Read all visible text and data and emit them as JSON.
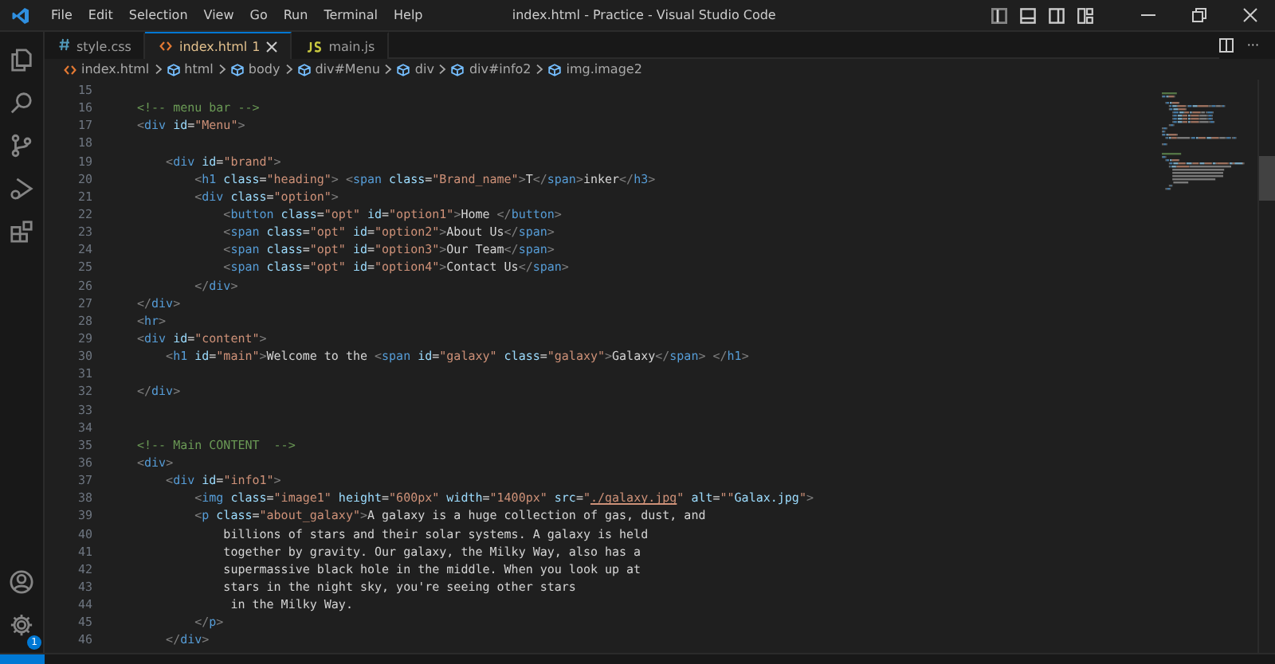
{
  "window": {
    "title": "index.html - Practice - Visual Studio Code"
  },
  "menu": [
    "File",
    "Edit",
    "Selection",
    "View",
    "Go",
    "Run",
    "Terminal",
    "Help"
  ],
  "tabs": [
    {
      "kind": "css",
      "label": "style.css",
      "selected": false
    },
    {
      "kind": "html",
      "label": "index.html",
      "problems": "1",
      "selected": true
    },
    {
      "kind": "js",
      "label": "main.js",
      "selected": false
    }
  ],
  "breadcrumbs": [
    {
      "kind": "file",
      "label": "index.html"
    },
    {
      "kind": "element",
      "label": "html"
    },
    {
      "kind": "element",
      "label": "body"
    },
    {
      "kind": "element",
      "label": "div#Menu"
    },
    {
      "kind": "element",
      "label": "div"
    },
    {
      "kind": "element",
      "label": "div#info2"
    },
    {
      "kind": "element",
      "label": "img.image2"
    }
  ],
  "editor_actions": {
    "more": "···"
  },
  "activity_bar": {
    "settings_badge": "1"
  },
  "editor": {
    "lines": [
      {
        "number": "15"
      },
      {
        "number": "16",
        "tokens": [
          {
            "kind": "comment",
            "text": "<!-- menu bar -->"
          }
        ]
      },
      {
        "number": "17",
        "tokens": [
          {
            "kind": "punct",
            "text": "<"
          },
          {
            "kind": "tag",
            "text": "div"
          },
          {
            "kind": "attr",
            "text": " id"
          },
          {
            "kind": "text",
            "text": "="
          },
          {
            "kind": "str",
            "text": "\"Menu\""
          },
          {
            "kind": "punct",
            "text": ">"
          }
        ]
      },
      {
        "number": "18"
      },
      {
        "number": "19",
        "tokens": [
          {
            "kind": "punct",
            "text": "    <"
          },
          {
            "kind": "tag",
            "text": "div"
          },
          {
            "kind": "attr",
            "text": " id"
          },
          {
            "kind": "text",
            "text": "="
          },
          {
            "kind": "str",
            "text": "\"brand\""
          },
          {
            "kind": "punct",
            "text": ">"
          }
        ]
      },
      {
        "number": "20",
        "tokens": [
          {
            "kind": "punct",
            "text": "        <"
          },
          {
            "kind": "tag",
            "text": "h1"
          },
          {
            "kind": "attr",
            "text": " class"
          },
          {
            "kind": "text",
            "text": "="
          },
          {
            "kind": "str",
            "text": "\"heading\""
          },
          {
            "kind": "punct",
            "text": ">"
          },
          {
            "kind": "punct",
            "text": " <"
          },
          {
            "kind": "tag",
            "text": "span"
          },
          {
            "kind": "attr",
            "text": " class"
          },
          {
            "kind": "text",
            "text": "="
          },
          {
            "kind": "str",
            "text": "\"Brand_name\""
          },
          {
            "kind": "punct",
            "text": ">"
          },
          {
            "kind": "text",
            "text": "T"
          },
          {
            "kind": "punct",
            "text": "</"
          },
          {
            "kind": "tag",
            "text": "span"
          },
          {
            "kind": "punct",
            "text": ">"
          },
          {
            "kind": "text",
            "text": "inker"
          },
          {
            "kind": "punct",
            "text": "</"
          },
          {
            "kind": "tag",
            "text": "h3"
          },
          {
            "kind": "punct",
            "text": ">"
          }
        ]
      },
      {
        "number": "21",
        "tokens": [
          {
            "kind": "punct",
            "text": "        <"
          },
          {
            "kind": "tag",
            "text": "div"
          },
          {
            "kind": "attr",
            "text": " class"
          },
          {
            "kind": "text",
            "text": "="
          },
          {
            "kind": "str",
            "text": "\"option\""
          },
          {
            "kind": "punct",
            "text": ">"
          }
        ]
      },
      {
        "number": "22",
        "tokens": [
          {
            "kind": "punct",
            "text": "            <"
          },
          {
            "kind": "tag",
            "text": "button"
          },
          {
            "kind": "attr",
            "text": " class"
          },
          {
            "kind": "text",
            "text": "="
          },
          {
            "kind": "str",
            "text": "\"opt\""
          },
          {
            "kind": "attr",
            "text": " id"
          },
          {
            "kind": "text",
            "text": "="
          },
          {
            "kind": "str",
            "text": "\"option1\""
          },
          {
            "kind": "punct",
            "text": ">"
          },
          {
            "kind": "text",
            "text": "Home "
          },
          {
            "kind": "punct",
            "text": "</"
          },
          {
            "kind": "tag",
            "text": "button"
          },
          {
            "kind": "punct",
            "text": ">"
          }
        ]
      },
      {
        "number": "23",
        "tokens": [
          {
            "kind": "punct",
            "text": "            <"
          },
          {
            "kind": "tag",
            "text": "span"
          },
          {
            "kind": "attr",
            "text": " class"
          },
          {
            "kind": "text",
            "text": "="
          },
          {
            "kind": "str",
            "text": "\"opt\""
          },
          {
            "kind": "attr",
            "text": " id"
          },
          {
            "kind": "text",
            "text": "="
          },
          {
            "kind": "str",
            "text": "\"option2\""
          },
          {
            "kind": "punct",
            "text": ">"
          },
          {
            "kind": "text",
            "text": "About Us"
          },
          {
            "kind": "punct",
            "text": "</"
          },
          {
            "kind": "tag",
            "text": "span"
          },
          {
            "kind": "punct",
            "text": ">"
          }
        ]
      },
      {
        "number": "24",
        "tokens": [
          {
            "kind": "punct",
            "text": "            <"
          },
          {
            "kind": "tag",
            "text": "span"
          },
          {
            "kind": "attr",
            "text": " class"
          },
          {
            "kind": "text",
            "text": "="
          },
          {
            "kind": "str",
            "text": "\"opt\""
          },
          {
            "kind": "attr",
            "text": " id"
          },
          {
            "kind": "text",
            "text": "="
          },
          {
            "kind": "str",
            "text": "\"option3\""
          },
          {
            "kind": "punct",
            "text": ">"
          },
          {
            "kind": "text",
            "text": "Our Team"
          },
          {
            "kind": "punct",
            "text": "</"
          },
          {
            "kind": "tag",
            "text": "span"
          },
          {
            "kind": "punct",
            "text": ">"
          }
        ]
      },
      {
        "number": "25",
        "tokens": [
          {
            "kind": "punct",
            "text": "            <"
          },
          {
            "kind": "tag",
            "text": "span"
          },
          {
            "kind": "attr",
            "text": " class"
          },
          {
            "kind": "text",
            "text": "="
          },
          {
            "kind": "str",
            "text": "\"opt\""
          },
          {
            "kind": "attr",
            "text": " id"
          },
          {
            "kind": "text",
            "text": "="
          },
          {
            "kind": "str",
            "text": "\"option4\""
          },
          {
            "kind": "punct",
            "text": ">"
          },
          {
            "kind": "text",
            "text": "Contact Us"
          },
          {
            "kind": "punct",
            "text": "</"
          },
          {
            "kind": "tag",
            "text": "span"
          },
          {
            "kind": "punct",
            "text": ">"
          }
        ]
      },
      {
        "number": "26",
        "tokens": [
          {
            "kind": "punct",
            "text": "        </"
          },
          {
            "kind": "tag",
            "text": "div"
          },
          {
            "kind": "punct",
            "text": ">"
          }
        ]
      },
      {
        "number": "27",
        "tokens": [
          {
            "kind": "punct",
            "text": "</"
          },
          {
            "kind": "tag",
            "text": "div"
          },
          {
            "kind": "punct",
            "text": ">"
          }
        ]
      },
      {
        "number": "28",
        "tokens": [
          {
            "kind": "punct",
            "text": "<"
          },
          {
            "kind": "tag",
            "text": "hr"
          },
          {
            "kind": "punct",
            "text": ">"
          }
        ]
      },
      {
        "number": "29",
        "tokens": [
          {
            "kind": "punct",
            "text": "<"
          },
          {
            "kind": "tag",
            "text": "div"
          },
          {
            "kind": "attr",
            "text": " id"
          },
          {
            "kind": "text",
            "text": "="
          },
          {
            "kind": "str",
            "text": "\"content\""
          },
          {
            "kind": "punct",
            "text": ">"
          }
        ]
      },
      {
        "number": "30",
        "tokens": [
          {
            "kind": "punct",
            "text": "    <"
          },
          {
            "kind": "tag",
            "text": "h1"
          },
          {
            "kind": "attr",
            "text": " id"
          },
          {
            "kind": "text",
            "text": "="
          },
          {
            "kind": "str",
            "text": "\"main\""
          },
          {
            "kind": "punct",
            "text": ">"
          },
          {
            "kind": "text",
            "text": "Welcome to the "
          },
          {
            "kind": "punct",
            "text": "<"
          },
          {
            "kind": "tag",
            "text": "span"
          },
          {
            "kind": "attr",
            "text": " id"
          },
          {
            "kind": "text",
            "text": "="
          },
          {
            "kind": "str",
            "text": "\"galaxy\""
          },
          {
            "kind": "attr",
            "text": " class"
          },
          {
            "kind": "text",
            "text": "="
          },
          {
            "kind": "str",
            "text": "\"galaxy\""
          },
          {
            "kind": "punct",
            "text": ">"
          },
          {
            "kind": "text",
            "text": "Galaxy"
          },
          {
            "kind": "punct",
            "text": "</"
          },
          {
            "kind": "tag",
            "text": "span"
          },
          {
            "kind": "punct",
            "text": ">"
          },
          {
            "kind": "punct",
            "text": " </"
          },
          {
            "kind": "tag",
            "text": "h1"
          },
          {
            "kind": "punct",
            "text": ">"
          }
        ]
      },
      {
        "number": "31"
      },
      {
        "number": "32",
        "tokens": [
          {
            "kind": "punct",
            "text": "</"
          },
          {
            "kind": "tag",
            "text": "div"
          },
          {
            "kind": "punct",
            "text": ">"
          }
        ]
      },
      {
        "number": "33"
      },
      {
        "number": "34"
      },
      {
        "number": "35",
        "tokens": [
          {
            "kind": "comment",
            "text": "<!-- Main CONTENT  -->"
          }
        ]
      },
      {
        "number": "36",
        "tokens": [
          {
            "kind": "punct",
            "text": "<"
          },
          {
            "kind": "tag",
            "text": "div"
          },
          {
            "kind": "punct",
            "text": ">"
          }
        ]
      },
      {
        "number": "37",
        "tokens": [
          {
            "kind": "punct",
            "text": "    <"
          },
          {
            "kind": "tag",
            "text": "div"
          },
          {
            "kind": "attr",
            "text": " id"
          },
          {
            "kind": "text",
            "text": "="
          },
          {
            "kind": "str",
            "text": "\"info1\""
          },
          {
            "kind": "punct",
            "text": ">"
          }
        ]
      },
      {
        "number": "38",
        "tokens": [
          {
            "kind": "punct",
            "text": "        <"
          },
          {
            "kind": "tag",
            "text": "img"
          },
          {
            "kind": "attr",
            "text": " class"
          },
          {
            "kind": "text",
            "text": "="
          },
          {
            "kind": "str",
            "text": "\"image1\""
          },
          {
            "kind": "attr",
            "text": " height"
          },
          {
            "kind": "text",
            "text": "="
          },
          {
            "kind": "str",
            "text": "\"600px\""
          },
          {
            "kind": "attr",
            "text": " width"
          },
          {
            "kind": "text",
            "text": "="
          },
          {
            "kind": "str",
            "text": "\"1400px\""
          },
          {
            "kind": "attr",
            "text": " src"
          },
          {
            "kind": "text",
            "text": "="
          },
          {
            "kind": "str",
            "text": "\""
          },
          {
            "kind": "link",
            "text": "./galaxy.jpg"
          },
          {
            "kind": "str",
            "text": "\""
          },
          {
            "kind": "attr",
            "text": " alt"
          },
          {
            "kind": "text",
            "text": "="
          },
          {
            "kind": "str",
            "text": "\"\""
          },
          {
            "kind": "attr",
            "text": "Galax.jpg"
          },
          {
            "kind": "str",
            "text": "\""
          },
          {
            "kind": "punct",
            "text": ">"
          }
        ]
      },
      {
        "number": "39",
        "tokens": [
          {
            "kind": "punct",
            "text": "        <"
          },
          {
            "kind": "tag",
            "text": "p"
          },
          {
            "kind": "attr",
            "text": " class"
          },
          {
            "kind": "text",
            "text": "="
          },
          {
            "kind": "str",
            "text": "\"about_galaxy\""
          },
          {
            "kind": "punct",
            "text": ">"
          },
          {
            "kind": "text",
            "text": "A galaxy is a huge collection of gas, dust, and"
          }
        ]
      },
      {
        "number": "40",
        "tokens": [
          {
            "kind": "text",
            "text": "            billions of stars and their solar systems. A galaxy is held"
          }
        ]
      },
      {
        "number": "41",
        "tokens": [
          {
            "kind": "text",
            "text": "            together by gravity. Our galaxy, the Milky Way, also has a"
          }
        ]
      },
      {
        "number": "42",
        "tokens": [
          {
            "kind": "text",
            "text": "            supermassive black hole in the middle. When you look up at"
          }
        ]
      },
      {
        "number": "43",
        "tokens": [
          {
            "kind": "text",
            "text": "            stars in the night sky, you're seeing other stars"
          }
        ]
      },
      {
        "number": "44",
        "tokens": [
          {
            "kind": "text",
            "text": "             in the Milky Way."
          }
        ]
      },
      {
        "number": "45",
        "tokens": [
          {
            "kind": "punct",
            "text": "        </"
          },
          {
            "kind": "tag",
            "text": "p"
          },
          {
            "kind": "punct",
            "text": ">"
          }
        ]
      },
      {
        "number": "46",
        "tokens": [
          {
            "kind": "punct",
            "text": "    </"
          },
          {
            "kind": "tag",
            "text": "div"
          },
          {
            "kind": "punct",
            "text": ">"
          }
        ]
      }
    ]
  }
}
